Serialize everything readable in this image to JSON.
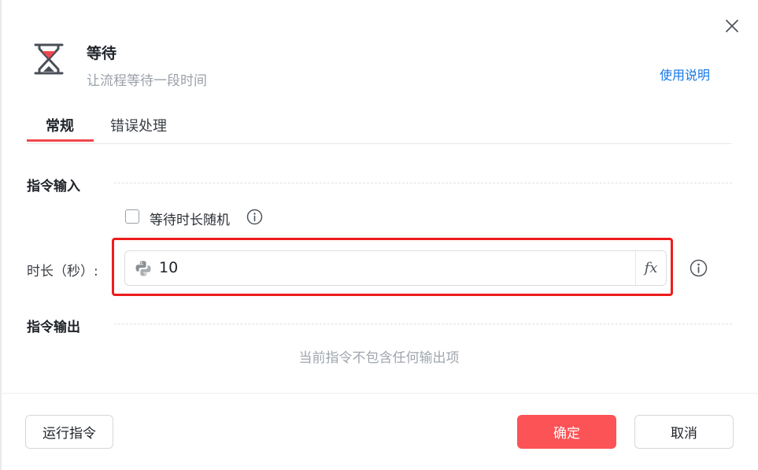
{
  "header": {
    "title": "等待",
    "subtitle": "让流程等待一段时间",
    "help_link": "使用说明"
  },
  "tabs": [
    {
      "label": "常规",
      "active": true
    },
    {
      "label": "错误处理",
      "active": false
    }
  ],
  "input_section": {
    "title": "指令输入",
    "random_checkbox": {
      "label": "等待时长随机",
      "checked": false
    },
    "duration": {
      "label": "时长（秒）:",
      "value": "10",
      "fx_label": "fx"
    }
  },
  "output_section": {
    "title": "指令输出",
    "empty_message": "当前指令不包含任何输出项"
  },
  "footer": {
    "run_label": "运行指令",
    "ok_label": "确定",
    "cancel_label": "取消"
  },
  "colors": {
    "accent": "#f0484f",
    "primary_button": "#fc5356",
    "link": "#1677e8",
    "highlight_border": "#ee1c1c"
  },
  "icons": {
    "header": "hourglass-icon",
    "close": "close-icon",
    "info": "info-icon",
    "input_prefix": "python-icon"
  }
}
